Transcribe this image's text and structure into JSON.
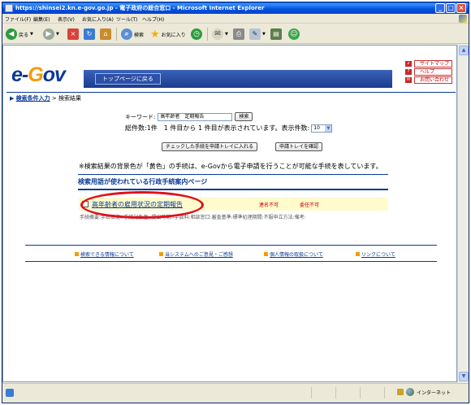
{
  "window": {
    "title": "https://shinsei2.kn.e-gov.go.jp - 電子政府の総合窓口 - Microsoft Internet Explorer"
  },
  "menubar": {
    "items": [
      "ファイル(F)",
      "編集(E)",
      "表示(V)",
      "お気に入り(A)",
      "ツール(T)",
      "ヘルプ(H)"
    ]
  },
  "toolbar": {
    "back_label": "戻る",
    "search_label": "検索",
    "favorites_label": "お気に入り"
  },
  "header": {
    "logo_prefix": "e-",
    "logo_o": "G",
    "logo_suffix": "ov",
    "top_button": "トップページに戻る",
    "side_links": [
      "サイトマップ",
      "ヘルプ",
      "お問い合わせ"
    ]
  },
  "breadcrumb": {
    "link": "検索条件入力",
    "separator": ">",
    "current": "検索結果"
  },
  "search": {
    "keyword_label": "キーワード:",
    "keyword_value": "高年齢者　定期報告",
    "search_button": "検索",
    "total_text": "総件数:1件　1 件目から 1 件目が表示されています。表示件数:",
    "per_page": "10",
    "add_tray_button": "チェックした手続を申請トレイに入れる",
    "view_tray_button": "申請トレイを確認"
  },
  "note": "※検索結果の背景色が「黄色」の手続は、e-Govから電子申請を行うことが可能な手続を表しています。",
  "section": {
    "title": "検索用語が使われている行政手続案内ページ"
  },
  "result": {
    "name": "高年齢者の雇用状況の定期報告",
    "flag1": "連名不可",
    "flag2": "委任不可",
    "meta": "手続概要:手続根拠:-手続対象者:-提出時期:-手数料:相談窓口:審査基準:標準処理期間:不服申立方法:備考:"
  },
  "footer": {
    "links": [
      "検索できる情報について",
      "当システムへのご意見・ご感想",
      "個人情報の取扱について",
      "リンクについて"
    ]
  },
  "statusbar": {
    "zone": "インターネット"
  }
}
